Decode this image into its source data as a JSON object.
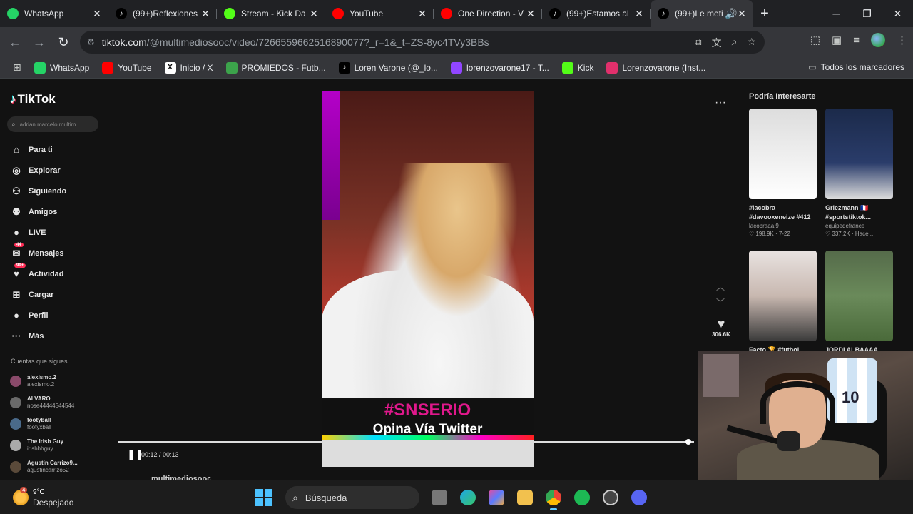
{
  "browser": {
    "tabs": [
      {
        "title": "WhatsApp",
        "icon": "whatsapp-icon",
        "color": "#25d366",
        "active": false
      },
      {
        "title": "(99+)Reflexiones",
        "icon": "tiktok-icon",
        "color": "#000000",
        "active": false
      },
      {
        "title": "Stream - Kick Da",
        "icon": "kick-icon",
        "color": "#53fc18",
        "active": false
      },
      {
        "title": "YouTube",
        "icon": "youtube-icon",
        "color": "#ff0000",
        "active": false
      },
      {
        "title": "One Direction - V",
        "icon": "youtube-icon",
        "color": "#ff0000",
        "active": false
      },
      {
        "title": "(99+)Estamos al",
        "icon": "tiktok-icon",
        "color": "#000000",
        "active": false
      },
      {
        "title": "(99+)Le meti",
        "icon": "tiktok-icon",
        "color": "#000000",
        "active": true
      }
    ],
    "url_host": "tiktok.com",
    "url_rest": "/@multimediosooc/video/7266559662516890077?_r=1&_t=ZS-8yc4TVy3BBs",
    "bookmarks": [
      {
        "label": "WhatsApp",
        "icon": "whatsapp-icon",
        "color": "#25d366"
      },
      {
        "label": "YouTube",
        "icon": "youtube-icon",
        "color": "#ff0000"
      },
      {
        "label": "Inicio / X",
        "icon": "x-icon",
        "color": "#ffffff"
      },
      {
        "label": "PROMIEDOS - Futb...",
        "icon": "promiedos-icon",
        "color": "#3ca34b"
      },
      {
        "label": "Loren Varone (@_lo...",
        "icon": "tiktok-icon",
        "color": "#000000"
      },
      {
        "label": "lorenzovarone17 - T...",
        "icon": "twitch-icon",
        "color": "#9146ff"
      },
      {
        "label": "Kick",
        "icon": "kick-icon",
        "color": "#53fc18"
      },
      {
        "label": "Lorenzovarone (Inst...",
        "icon": "instagram-icon",
        "color": "#e1306c"
      }
    ],
    "all_bookmarks": "Todos los marcadores"
  },
  "tiktok": {
    "logo": "TikTok",
    "search_placeholder": "adrian marcelo multim...",
    "menu": [
      {
        "label": "Para ti",
        "icon": "home-icon",
        "glyph": "⌂"
      },
      {
        "label": "Explorar",
        "icon": "compass-icon",
        "glyph": "◎"
      },
      {
        "label": "Siguiendo",
        "icon": "following-icon",
        "glyph": "⚇"
      },
      {
        "label": "Amigos",
        "icon": "friends-icon",
        "glyph": "⚉"
      },
      {
        "label": "LIVE",
        "icon": "live-icon",
        "glyph": "●"
      },
      {
        "label": "Mensajes",
        "icon": "messages-icon",
        "glyph": "✉",
        "badge": "44"
      },
      {
        "label": "Actividad",
        "icon": "activity-icon",
        "glyph": "♥",
        "badge": "99+"
      },
      {
        "label": "Cargar",
        "icon": "upload-icon",
        "glyph": "⊞"
      },
      {
        "label": "Perfil",
        "icon": "profile-icon",
        "glyph": "●"
      },
      {
        "label": "Más",
        "icon": "more-icon",
        "glyph": "···"
      }
    ],
    "following_title": "Cuentas que sigues",
    "following": [
      {
        "name": "alexismo.2",
        "handle": "alexismo.2"
      },
      {
        "name": "ALVARO",
        "handle": "nose44444544544"
      },
      {
        "name": "footyball",
        "handle": "footyxball"
      },
      {
        "name": "The Irish Guy",
        "handle": "irishhhguy"
      },
      {
        "name": "Agustin Carrizo9...",
        "handle": "agustincarrizo52"
      }
    ],
    "video": {
      "hashtag": "#SNSERIO",
      "subtitle": "Opina Vía Twitter",
      "time": "00:12 / 00:13",
      "progress": 0.99,
      "author": "multimediosooc"
    },
    "likes": "306.6K",
    "recommend_title": "Podría Interesarte",
    "recommendations": [
      {
        "title": "#lacobra #davooxeneize #412",
        "author": "lacobraaa.9",
        "stats": "♡ 198.9K · 7-22"
      },
      {
        "title": "Griezmann 🇫🇷 #sportstiktok...",
        "author": "equipedefrance",
        "stats": "♡ 337.2K · Hace..."
      },
      {
        "title": "Facto 🏆 #futbol",
        "author": "",
        "stats": ""
      },
      {
        "title": "JORDI ALBAAAA",
        "author": "",
        "stats": ""
      }
    ]
  },
  "webcam": {
    "jersey_number": "10"
  },
  "taskbar": {
    "temp": "9°C",
    "condition": "Despejado",
    "weather_badge": "4",
    "search": "Búsqueda"
  }
}
